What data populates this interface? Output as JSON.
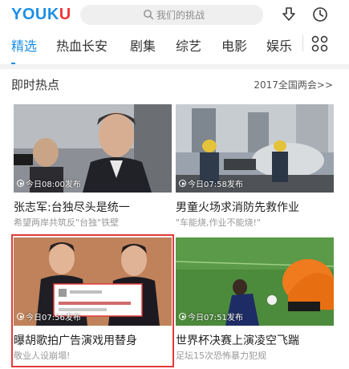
{
  "header": {
    "logo_main": "YOUK",
    "logo_tail": "U",
    "search_placeholder": "我们的挑战"
  },
  "tabs": [
    {
      "label": "精选",
      "active": true
    },
    {
      "label": "热血长安"
    },
    {
      "label": "剧集"
    },
    {
      "label": "综艺"
    },
    {
      "label": "电影"
    },
    {
      "label": "娱乐"
    }
  ],
  "section": {
    "title": "即时热点",
    "more": "2017全国两会>>"
  },
  "cards": [
    {
      "time": "今日08:00发布",
      "title": "张志军:台独尽头是统一",
      "subtitle": "希望两岸共筑反\"台独\"铁壁"
    },
    {
      "time": "今日07:58发布",
      "title": "男童火场求消防先救作业",
      "subtitle": "\"车能烧,作业不能烧!\""
    },
    {
      "time": "今日07:56发布",
      "title": "曝胡歌拍广告演戏用替身",
      "subtitle": "敬业人设崩塌!"
    },
    {
      "time": "今日07:51发布",
      "title": "世界杯决赛上演凌空飞踹",
      "subtitle": "足坛15次恐怖暴力犯规"
    }
  ],
  "colors": {
    "brand_blue": "#1e8fe6",
    "logo_red": "#f0343b",
    "highlight_red": "#e23a3a"
  }
}
